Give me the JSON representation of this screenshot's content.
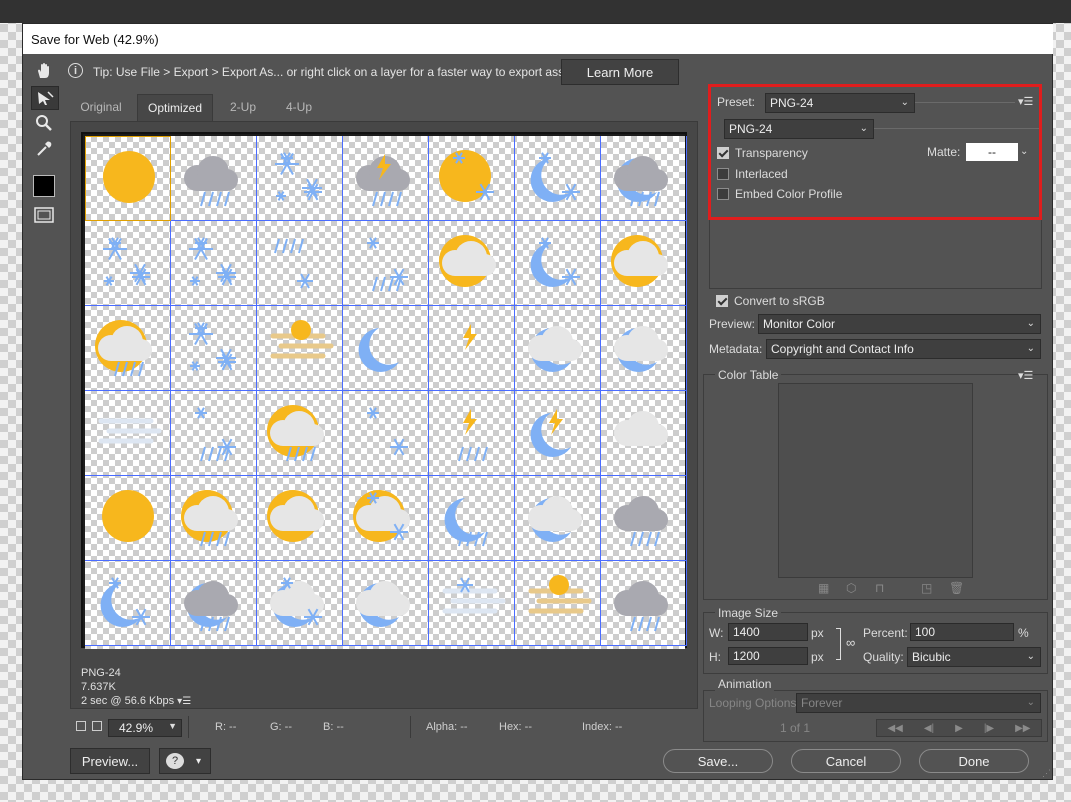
{
  "window": {
    "title": "Save for Web (42.9%)"
  },
  "tip": {
    "text": "Tip: Use File > Export > Export As...  or right click on a layer for a faster way to export assets",
    "learn_more": "Learn More"
  },
  "tabs": [
    "Original",
    "Optimized",
    "2-Up",
    "4-Up"
  ],
  "active_tab": "Optimized",
  "tools": [
    "hand-tool-icon",
    "slice-select-tool-icon",
    "zoom-tool-icon",
    "eyedropper-tool-icon",
    "color-swatch",
    "toggle-slices-icon"
  ],
  "optimized_info": {
    "format": "PNG-24",
    "size": "7.637K",
    "speed": "2 sec @ 56.6 Kbps"
  },
  "status": {
    "zoom": "42.9%",
    "r": "R: --",
    "g": "G: --",
    "b": "B: --",
    "alpha": "Alpha: --",
    "hex": "Hex: --",
    "index": "Index: --"
  },
  "buttons": {
    "preview": "Preview...",
    "save": "Save...",
    "cancel": "Cancel",
    "done": "Done"
  },
  "preset": {
    "label": "Preset:",
    "value": "PNG-24",
    "format": "PNG-24"
  },
  "options": {
    "transparency": {
      "label": "Transparency",
      "checked": true
    },
    "interlaced": {
      "label": "Interlaced",
      "checked": false
    },
    "embed_profile": {
      "label": "Embed Color Profile",
      "checked": false
    },
    "matte_label": "Matte:",
    "matte_value": "--"
  },
  "convert_srgb": {
    "label": "Convert to sRGB",
    "checked": true
  },
  "preview_setting": {
    "label": "Preview:",
    "value": "Monitor Color"
  },
  "metadata": {
    "label": "Metadata:",
    "value": "Copyright and Contact Info"
  },
  "color_table": {
    "title": "Color Table"
  },
  "image_size": {
    "title": "Image Size",
    "w_label": "W:",
    "w": "1400",
    "h_label": "H:",
    "h": "1200",
    "unit": "px",
    "percent_label": "Percent:",
    "percent": "100",
    "percent_unit": "%",
    "quality_label": "Quality:",
    "quality": "Bicubic"
  },
  "animation": {
    "title": "Animation",
    "looping_label": "Looping Options:",
    "looping": "Forever",
    "frame": "1 of 1"
  },
  "highlight_color": "#e01d1d",
  "icon_grid": {
    "rows": 6,
    "cols": 7,
    "cell_names": [
      "sun",
      "rain-cloud",
      "snowflakes",
      "thunder-rain-cloud",
      "sun-snow",
      "moon-snow",
      "moon-rain-cloud",
      "snowflakes",
      "snowflakes",
      "sleet",
      "rain-snow",
      "sun-cloud",
      "moon-snow",
      "sun-cloud",
      "sun-rain-cloud",
      "snowflakes",
      "fog-sun",
      "moon",
      "thunder-sun",
      "cloud-moon",
      "cloud-moon",
      "fog",
      "rain-snow",
      "sun-rain-cloud",
      "snow-sun",
      "rain-thunder-sun",
      "thunder-moon",
      "cloud",
      "sun",
      "sun-rain-cloud",
      "sun-cloud",
      "sun-snow-cloud",
      "moon-rain",
      "moon-cloud",
      "rain-cloud",
      "moon-snow",
      "moon-rain-cloud",
      "moon-snow-cloud",
      "moon-cloud",
      "fog-snow",
      "fog-sun",
      "rain-cloud"
    ]
  }
}
